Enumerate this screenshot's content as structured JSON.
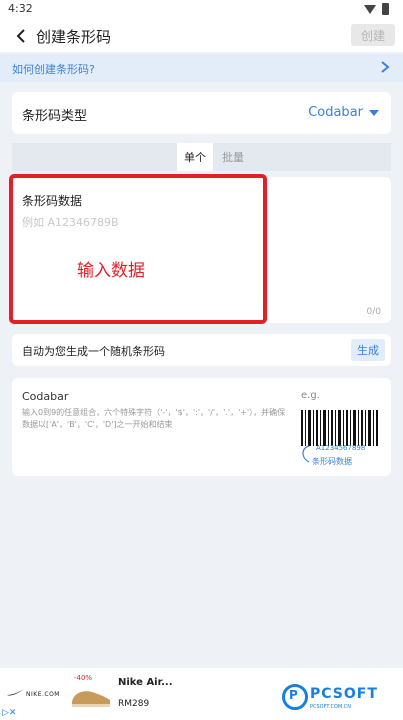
{
  "status_bar": {
    "time": "4:32"
  },
  "app_bar": {
    "title": "创建条形码",
    "create_label": "创建"
  },
  "help": {
    "text": "如何创建条形码?"
  },
  "type_row": {
    "label": "条形码类型",
    "value": "Codabar"
  },
  "tabs": [
    {
      "label": "单个",
      "active": true
    },
    {
      "label": "批量",
      "active": false
    }
  ],
  "data_card": {
    "heading": "条形码数据",
    "placeholder": "例如 A12346789B",
    "value": "",
    "counter": "0/0"
  },
  "annotation": {
    "text": "输入数据",
    "color": "#e3202a"
  },
  "random_row": {
    "label": "自动为您生成一个随机条形码",
    "button_label": "生成"
  },
  "info": {
    "name": "Codabar",
    "description": "输入0到9的任意组合，六个特殊字符（'-'，'$'，':'，'/'，'.'，'+'），并确保数据以['A'，'B'，'C'，'D']之一开始和结束",
    "example_label": "e.g.",
    "example_code": "A1234567898",
    "example_caption": "条形码数据"
  },
  "ad": {
    "brand": "NIKE.COM",
    "discount": "-40%",
    "title": "Nike Air...",
    "price": "RM289",
    "watermark_brand": "PCSOFT",
    "watermark_sub": "PCSOFT.COM.CN"
  },
  "colors": {
    "accent": "#3b82d6",
    "highlight": "#e3202a",
    "background": "#eef2f7"
  }
}
